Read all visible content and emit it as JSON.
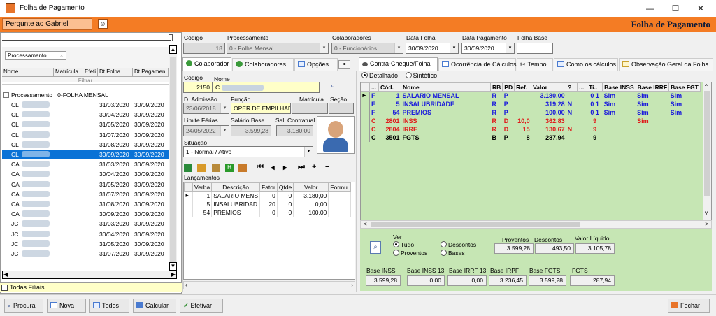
{
  "window": {
    "title": "Folha de Pagamento",
    "minimize": "—",
    "maximize": "☐",
    "close": "✕"
  },
  "topbar": {
    "ask": "Pergunte ao Gabriel",
    "title": "Folha de Pagamento"
  },
  "left": {
    "group_chip": "Processamento",
    "columns": [
      "Nome",
      "Matrícula",
      "Efeti",
      "Dt.Folha",
      "Dt.Pagamen"
    ],
    "filter": "Filtrar",
    "group_header": "Processamento : 0-FOLHA MENSAL",
    "rows": [
      {
        "name": "CL",
        "dt": "31/03/2020",
        "dp": "30/09/2020"
      },
      {
        "name": "CL",
        "dt": "30/04/2020",
        "dp": "30/09/2020"
      },
      {
        "name": "CL",
        "dt": "31/05/2020",
        "dp": "30/09/2020"
      },
      {
        "name": "CL",
        "dt": "31/07/2020",
        "dp": "30/09/2020"
      },
      {
        "name": "CL",
        "dt": "31/08/2020",
        "dp": "30/09/2020"
      },
      {
        "name": "CL",
        "dt": "30/09/2020",
        "dp": "30/09/2020"
      },
      {
        "name": "CA",
        "dt": "31/03/2020",
        "dp": "30/09/2020"
      },
      {
        "name": "CA",
        "dt": "30/04/2020",
        "dp": "30/09/2020"
      },
      {
        "name": "CA",
        "dt": "31/05/2020",
        "dp": "30/09/2020"
      },
      {
        "name": "CA",
        "dt": "31/07/2020",
        "dp": "30/09/2020"
      },
      {
        "name": "CA",
        "dt": "31/08/2020",
        "dp": "30/09/2020"
      },
      {
        "name": "CA",
        "dt": "30/09/2020",
        "dp": "30/09/2020"
      },
      {
        "name": "JC",
        "dt": "31/03/2020",
        "dp": "30/09/2020"
      },
      {
        "name": "JC",
        "dt": "30/04/2020",
        "dp": "30/09/2020"
      },
      {
        "name": "JC",
        "dt": "31/05/2020",
        "dp": "30/09/2020"
      },
      {
        "name": "JC",
        "dt": "31/07/2020",
        "dp": "30/09/2020"
      }
    ],
    "selected_index": 5,
    "todas_filiais": "Todas Filiais"
  },
  "header": {
    "codigo_label": "Código",
    "codigo": "18",
    "processamento_label": "Processamento",
    "processamento": "0 - Folha Mensal",
    "colaboradores_label": "Colaboradores",
    "colaboradores": "0 - Funcionários",
    "data_folha_label": "Data Folha",
    "data_folha": "30/09/2020",
    "data_pagamento_label": "Data Pagamento",
    "data_pagamento": "30/09/2020",
    "folha_base_label": "Folha Base",
    "folha_base": ""
  },
  "tabs_mid": [
    "Colaborador",
    "Colaboradores",
    "Opções"
  ],
  "colab": {
    "codigo_label": "Código",
    "nome_label": "Nome",
    "codigo": "2150",
    "nome": "C",
    "admissao_label": "D. Admissão",
    "admissao": "23/06/2018",
    "funcao_label": "Função",
    "funcao": "OPER DE EMPILHAD",
    "matricula_label": "Matrícula",
    "secao_label": "Seção",
    "limite_label": "Limite Férias",
    "limite": "24/05/2022",
    "salario_label": "Salário Base",
    "salario": "3.599,28",
    "salcont_label": "Sal. Contratual",
    "salcont": "3.180,00",
    "situacao_label": "Situação",
    "situacao": "1 - Normal / Ativo",
    "lancamentos_label": "Lançamentos",
    "lanc_cols": [
      "Verba",
      "Descrição",
      "Fator",
      "Qtde",
      "Valor",
      "Formu"
    ],
    "lanc_rows": [
      {
        "verba": "1",
        "desc": "SALARIO MENS",
        "fator": "0",
        "qtde": "0",
        "valor": "3.180,00"
      },
      {
        "verba": "5",
        "desc": "INSALUBRIDAD",
        "fator": "20",
        "qtde": "0",
        "valor": "0,00"
      },
      {
        "verba": "54",
        "desc": "PREMIOS",
        "fator": "0",
        "qtde": "0",
        "valor": "100,00"
      }
    ]
  },
  "tabs_right": [
    "Contra-Cheque/Folha",
    "Ocorrência de Cálculos",
    "Tempo",
    "Como os cálculos",
    "Observação Geral da Folha"
  ],
  "view": {
    "detalhado": "Detalhado",
    "sintetico": "Sintético"
  },
  "cc": {
    "cols": [
      "...",
      "Cód.",
      "Nome",
      "RB",
      "PD",
      "Ref.",
      "Valor",
      "?",
      "...",
      "Ti..",
      "Base INSS",
      "Base IRRF",
      "Base FGT"
    ],
    "rows": [
      {
        "tipo": "F",
        "cod": "1",
        "nome": "SALARIO MENSAL",
        "rb": "R",
        "pd": "P",
        "ref": "",
        "valor": "3.180,00",
        "flag": "",
        "ti": "0 1",
        "inss": "Sim",
        "irrf": "Sim",
        "fgts": "Sim",
        "color": "#1a1adc"
      },
      {
        "tipo": "F",
        "cod": "5",
        "nome": "INSALUBRIDADE",
        "rb": "R",
        "pd": "P",
        "ref": "",
        "valor": "319,28",
        "flag": "N",
        "ti": "0 1",
        "inss": "Sim",
        "irrf": "Sim",
        "fgts": "Sim",
        "color": "#1a1adc"
      },
      {
        "tipo": "F",
        "cod": "54",
        "nome": "PREMIOS",
        "rb": "R",
        "pd": "P",
        "ref": "",
        "valor": "100,00",
        "flag": "N",
        "ti": "0 1",
        "inss": "Sim",
        "irrf": "Sim",
        "fgts": "Sim",
        "color": "#1a1adc"
      },
      {
        "tipo": "C",
        "cod": "2801",
        "nome": "INSS",
        "rb": "R",
        "pd": "D",
        "ref": "10,0",
        "valor": "362,83",
        "flag": "",
        "ti": "9",
        "inss": "",
        "irrf": "Sim",
        "fgts": "",
        "color": "#e01a1a"
      },
      {
        "tipo": "C",
        "cod": "2804",
        "nome": "IRRF",
        "rb": "R",
        "pd": "D",
        "ref": "15",
        "valor": "130,67",
        "flag": "N",
        "ti": "9",
        "inss": "",
        "irrf": "",
        "fgts": "",
        "color": "#e01a1a"
      },
      {
        "tipo": "C",
        "cod": "3501",
        "nome": "FGTS",
        "rb": "B",
        "pd": "P",
        "ref": "8",
        "valor": "287,94",
        "flag": "",
        "ti": "9",
        "inss": "",
        "irrf": "",
        "fgts": "",
        "color": "#000000"
      }
    ]
  },
  "totals": {
    "ver_label": "Ver",
    "tudo": "Tudo",
    "proventos_opt": "Proventos",
    "descontos_opt": "Descontos",
    "bases_opt": "Bases",
    "proventos_label": "Proventos",
    "proventos": "3.599,28",
    "descontos_label": "Descontos",
    "descontos": "493,50",
    "liquido_label": "Valor Líquido",
    "liquido": "3.105,78",
    "base_inss_label": "Base INSS",
    "base_inss": "3.599,28",
    "base_inss13_label": "Base INSS 13",
    "base_inss13": "0,00",
    "base_irrf13_label": "Base IRRF 13",
    "base_irrf13": "0,00",
    "base_irpf_label": "Base IRPF",
    "base_irpf": "3.236,45",
    "base_fgts_label": "Base FGTS",
    "base_fgts": "3.599,28",
    "fgts_label": "FGTS",
    "fgts": "287,94"
  },
  "bottom": {
    "procura": "Procura",
    "nova": "Nova",
    "todos": "Todos",
    "calcular": "Calcular",
    "efetivar": "Efetivar",
    "fechar": "Fechar"
  },
  "colors": {
    "orange": "#f47c24",
    "green": "#c6e6b4",
    "select": "#0a72d6"
  }
}
